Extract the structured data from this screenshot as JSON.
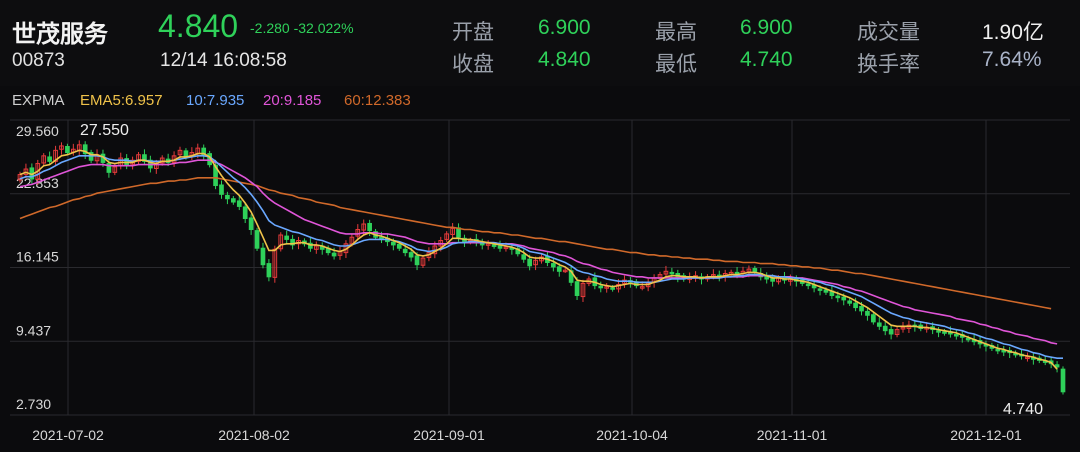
{
  "stock": {
    "name": "世茂服务",
    "code": "00873",
    "price": "4.840",
    "change": "-2.280",
    "change_pct": "-32.022%",
    "datetime": "12/14 16:08:58"
  },
  "quote": {
    "open_label": "开盘",
    "open": "6.900",
    "close_label": "收盘",
    "close": "4.840",
    "high_label": "最高",
    "high": "6.900",
    "low_label": "最低",
    "low": "4.740",
    "volume_label": "成交量",
    "volume": "1.90亿",
    "turnover_label": "换手率",
    "turnover": "7.64%"
  },
  "indicator": {
    "name": "EXPMA",
    "ema5": "EMA5:6.957",
    "ema10": "10:7.935",
    "ema20": "20:9.185",
    "ema60": "60:12.383",
    "colors": {
      "ema5": "#f0c34a",
      "ema10": "#6aa8ff",
      "ema20": "#e055d8",
      "ema60": "#d0692a"
    }
  },
  "colors": {
    "up": "#e63b3b",
    "down": "#2fd15a",
    "background": "#0b0b0d"
  },
  "chart_data": {
    "type": "candlestick",
    "y_ticks": [
      "29.560",
      "22.853",
      "16.145",
      "9.437",
      "2.730"
    ],
    "ylim": [
      2.73,
      29.56
    ],
    "x_ticks": [
      "2021-07-02",
      "2021-08-02",
      "2021-09-01",
      "2021-10-04",
      "2021-11-01",
      "2021-12-01"
    ],
    "annotations": {
      "max": "27.550",
      "min": "4.740"
    },
    "close_series": [
      24.6,
      25.1,
      24.2,
      25.6,
      26.3,
      25.8,
      26.8,
      27.2,
      26.6,
      26.9,
      27.3,
      26.5,
      25.9,
      26.4,
      25.7,
      24.8,
      25.3,
      26.1,
      25.5,
      25.9,
      26.4,
      25.8,
      25.2,
      25.6,
      26.1,
      25.7,
      26.3,
      26.8,
      26.2,
      26.6,
      27.0,
      26.4,
      25.5,
      23.6,
      22.8,
      22.4,
      22.1,
      21.7,
      20.6,
      19.6,
      17.9,
      16.4,
      15.3,
      17.8,
      19.1,
      18.7,
      18.2,
      18.6,
      18.3,
      17.9,
      18.1,
      17.8,
      17.5,
      17.2,
      17.6,
      18.3,
      18.9,
      19.6,
      20.1,
      19.5,
      18.9,
      18.7,
      18.5,
      18.2,
      17.9,
      17.5,
      17.1,
      16.4,
      17.0,
      17.5,
      18.1,
      18.6,
      19.2,
      19.7,
      18.9,
      18.5,
      18.6,
      18.4,
      18.2,
      18.3,
      18.1,
      17.9,
      18.0,
      17.8,
      17.4,
      16.9,
      16.3,
      16.8,
      17.1,
      16.6,
      16.2,
      15.8,
      15.9,
      14.8,
      13.6,
      14.7,
      15.1,
      14.5,
      14.3,
      14.4,
      14.2,
      14.6,
      15.0,
      14.8,
      14.5,
      14.4,
      14.7,
      15.2,
      15.5,
      15.8,
      15.6,
      15.3,
      15.1,
      15.2,
      15.4,
      15.1,
      15.3,
      15.5,
      15.3,
      15.6,
      15.7,
      15.5,
      15.8,
      16.0,
      15.7,
      15.3,
      15.1,
      14.9,
      15.2,
      15.0,
      15.1,
      14.9,
      14.7,
      14.5,
      14.3,
      14.1,
      13.9,
      13.6,
      13.4,
      13.2,
      12.9,
      12.5,
      12.2,
      11.8,
      11.2,
      10.8,
      10.4,
      10.1,
      10.5,
      10.7,
      10.9,
      10.8,
      10.6,
      10.7,
      10.5,
      10.3,
      10.2,
      10.1,
      10.0,
      9.8,
      9.6,
      9.4,
      9.2,
      9.0,
      8.8,
      8.6,
      8.5,
      8.4,
      8.2,
      8.1,
      8.0,
      7.8,
      7.7,
      7.6,
      7.4,
      7.1,
      4.84
    ],
    "ema5": [
      24.6,
      24.8,
      24.6,
      24.9,
      25.4,
      25.5,
      25.9,
      26.3,
      26.4,
      26.6,
      26.8,
      26.7,
      26.4,
      26.4,
      26.2,
      25.7,
      25.6,
      25.7,
      25.7,
      25.7,
      25.9,
      25.9,
      25.7,
      25.6,
      25.8,
      25.8,
      25.9,
      26.2,
      26.2,
      26.3,
      26.5,
      26.5,
      26.2,
      25.3,
      24.5,
      23.8,
      23.2,
      22.7,
      22.0,
      21.2,
      20.1,
      18.9,
      17.7,
      17.7,
      18.2,
      18.3,
      18.3,
      18.4,
      18.4,
      18.2,
      18.2,
      18.1,
      17.9,
      17.7,
      17.6,
      17.8,
      18.2,
      18.7,
      19.1,
      19.3,
      19.1,
      19.0,
      18.8,
      18.6,
      18.4,
      18.1,
      17.8,
      17.3,
      17.2,
      17.3,
      17.6,
      17.9,
      18.3,
      18.8,
      18.8,
      18.7,
      18.7,
      18.6,
      18.5,
      18.4,
      18.3,
      18.2,
      18.1,
      18.0,
      17.8,
      17.5,
      17.1,
      17.0,
      17.0,
      16.9,
      16.7,
      16.4,
      16.2,
      15.8,
      15.0,
      14.9,
      14.9,
      14.8,
      14.6,
      14.5,
      14.4,
      14.5,
      14.6,
      14.7,
      14.6,
      14.6,
      14.6,
      14.8,
      15.0,
      15.3,
      15.4,
      15.4,
      15.3,
      15.3,
      15.3,
      15.2,
      15.3,
      15.3,
      15.3,
      15.4,
      15.5,
      15.5,
      15.6,
      15.7,
      15.7,
      15.6,
      15.4,
      15.2,
      15.2,
      15.1,
      15.1,
      15.0,
      14.9,
      14.8,
      14.6,
      14.4,
      14.2,
      14.0,
      13.8,
      13.6,
      13.4,
      13.1,
      12.8,
      12.5,
      12.1,
      11.7,
      11.3,
      10.9,
      10.8,
      10.8,
      10.8,
      10.8,
      10.7,
      10.7,
      10.6,
      10.5,
      10.4,
      10.3,
      10.2,
      10.0,
      9.8,
      9.6,
      9.4,
      9.2,
      9.0,
      8.8,
      8.7,
      8.5,
      8.4,
      8.2,
      8.1,
      8.0,
      7.8,
      7.7,
      7.5,
      6.9
    ],
    "ema10": [
      24.2,
      24.4,
      24.4,
      24.6,
      24.9,
      25.1,
      25.4,
      25.7,
      25.9,
      26.1,
      26.3,
      26.3,
      26.3,
      26.3,
      26.2,
      26.0,
      25.9,
      25.9,
      25.9,
      25.8,
      25.9,
      25.9,
      25.8,
      25.8,
      25.8,
      25.8,
      25.9,
      26.0,
      26.1,
      26.2,
      26.3,
      26.3,
      26.2,
      25.8,
      25.3,
      24.8,
      24.3,
      23.9,
      23.4,
      22.8,
      22.1,
      21.3,
      20.4,
      20.0,
      19.8,
      19.6,
      19.4,
      19.3,
      19.1,
      18.9,
      18.7,
      18.6,
      18.4,
      18.2,
      18.1,
      18.1,
      18.2,
      18.4,
      18.6,
      18.7,
      18.7,
      18.7,
      18.7,
      18.6,
      18.5,
      18.3,
      18.1,
      17.8,
      17.7,
      17.6,
      17.7,
      17.8,
      18.0,
      18.3,
      18.4,
      18.4,
      18.5,
      18.5,
      18.4,
      18.4,
      18.4,
      18.3,
      18.3,
      18.2,
      18.1,
      17.9,
      17.6,
      17.5,
      17.4,
      17.2,
      17.0,
      16.8,
      16.6,
      16.3,
      15.9,
      15.7,
      15.6,
      15.4,
      15.3,
      15.1,
      15.0,
      14.9,
      14.9,
      14.9,
      14.8,
      14.8,
      14.8,
      14.8,
      14.9,
      15.0,
      15.1,
      15.1,
      15.1,
      15.2,
      15.2,
      15.2,
      15.2,
      15.2,
      15.2,
      15.3,
      15.3,
      15.4,
      15.4,
      15.5,
      15.5,
      15.5,
      15.4,
      15.4,
      15.3,
      15.3,
      15.2,
      15.2,
      15.1,
      15.0,
      14.9,
      14.8,
      14.6,
      14.5,
      14.3,
      14.1,
      13.9,
      13.7,
      13.5,
      13.2,
      12.9,
      12.6,
      12.3,
      12.0,
      11.8,
      11.6,
      11.5,
      11.3,
      11.2,
      11.1,
      11.0,
      10.9,
      10.8,
      10.6,
      10.5,
      10.4,
      10.2,
      10.1,
      9.9,
      9.7,
      9.6,
      9.4,
      9.2,
      9.1,
      8.9,
      8.7,
      8.6,
      8.4,
      8.3,
      8.1,
      8.0,
      7.9,
      7.9
    ],
    "ema20": [
      23.5,
      23.6,
      23.7,
      23.9,
      24.1,
      24.3,
      24.5,
      24.7,
      24.9,
      25.1,
      25.3,
      25.4,
      25.5,
      25.5,
      25.5,
      25.4,
      25.4,
      25.4,
      25.4,
      25.4,
      25.5,
      25.5,
      25.5,
      25.5,
      25.5,
      25.5,
      25.6,
      25.7,
      25.7,
      25.8,
      25.9,
      25.9,
      25.9,
      25.7,
      25.5,
      25.2,
      24.9,
      24.6,
      24.3,
      23.9,
      23.5,
      22.9,
      22.4,
      22.0,
      21.7,
      21.4,
      21.1,
      20.8,
      20.5,
      20.3,
      20.1,
      19.9,
      19.7,
      19.5,
      19.3,
      19.2,
      19.2,
      19.2,
      19.3,
      19.3,
      19.3,
      19.2,
      19.2,
      19.1,
      19.0,
      18.9,
      18.7,
      18.5,
      18.4,
      18.3,
      18.3,
      18.3,
      18.3,
      18.4,
      18.4,
      18.4,
      18.4,
      18.4,
      18.4,
      18.4,
      18.4,
      18.3,
      18.3,
      18.3,
      18.2,
      18.1,
      17.9,
      17.8,
      17.7,
      17.6,
      17.5,
      17.3,
      17.2,
      17.0,
      16.7,
      16.5,
      16.4,
      16.2,
      16.0,
      15.9,
      15.7,
      15.6,
      15.5,
      15.4,
      15.3,
      15.3,
      15.2,
      15.2,
      15.2,
      15.2,
      15.2,
      15.2,
      15.2,
      15.2,
      15.2,
      15.2,
      15.2,
      15.2,
      15.2,
      15.3,
      15.3,
      15.3,
      15.3,
      15.4,
      15.4,
      15.4,
      15.4,
      15.4,
      15.3,
      15.3,
      15.3,
      15.2,
      15.2,
      15.1,
      15.0,
      14.9,
      14.8,
      14.7,
      14.6,
      14.4,
      14.3,
      14.1,
      14.0,
      13.8,
      13.6,
      13.4,
      13.2,
      13.0,
      12.8,
      12.6,
      12.5,
      12.3,
      12.2,
      12.1,
      12.0,
      11.9,
      11.8,
      11.7,
      11.5,
      11.4,
      11.3,
      11.2,
      11.0,
      10.9,
      10.7,
      10.6,
      10.4,
      10.3,
      10.1,
      10.0,
      9.9,
      9.7,
      9.6,
      9.5,
      9.3,
      9.2
    ],
    "ema60": [
      20.6,
      20.8,
      21.0,
      21.2,
      21.4,
      21.6,
      21.7,
      21.9,
      22.1,
      22.3,
      22.4,
      22.6,
      22.7,
      22.9,
      23.0,
      23.1,
      23.2,
      23.3,
      23.4,
      23.5,
      23.6,
      23.7,
      23.8,
      23.8,
      23.9,
      24.0,
      24.0,
      24.1,
      24.1,
      24.2,
      24.3,
      24.3,
      24.3,
      24.3,
      24.2,
      24.1,
      24.0,
      23.9,
      23.8,
      23.7,
      23.6,
      23.4,
      23.2,
      23.1,
      22.9,
      22.8,
      22.7,
      22.5,
      22.4,
      22.3,
      22.1,
      22.0,
      21.9,
      21.8,
      21.6,
      21.5,
      21.4,
      21.3,
      21.2,
      21.1,
      21.0,
      20.9,
      20.8,
      20.7,
      20.6,
      20.5,
      20.4,
      20.3,
      20.2,
      20.1,
      20.0,
      19.9,
      19.8,
      19.8,
      19.7,
      19.6,
      19.6,
      19.5,
      19.4,
      19.4,
      19.3,
      19.3,
      19.2,
      19.1,
      19.1,
      19.0,
      18.9,
      18.8,
      18.8,
      18.7,
      18.6,
      18.5,
      18.5,
      18.4,
      18.3,
      18.2,
      18.1,
      18.0,
      17.9,
      17.8,
      17.8,
      17.7,
      17.6,
      17.5,
      17.5,
      17.4,
      17.3,
      17.3,
      17.2,
      17.2,
      17.1,
      17.1,
      17.0,
      17.0,
      16.9,
      16.9,
      16.9,
      16.8,
      16.8,
      16.7,
      16.7,
      16.7,
      16.6,
      16.6,
      16.6,
      16.5,
      16.5,
      16.5,
      16.4,
      16.4,
      16.3,
      16.3,
      16.2,
      16.2,
      16.1,
      16.1,
      16.0,
      15.9,
      15.9,
      15.8,
      15.7,
      15.6,
      15.6,
      15.5,
      15.4,
      15.3,
      15.2,
      15.1,
      15.0,
      14.9,
      14.8,
      14.7,
      14.6,
      14.5,
      14.4,
      14.3,
      14.2,
      14.1,
      14.0,
      13.9,
      13.8,
      13.7,
      13.6,
      13.5,
      13.4,
      13.3,
      13.2,
      13.1,
      13.0,
      12.9,
      12.8,
      12.7,
      12.6,
      12.5,
      12.4
    ]
  }
}
